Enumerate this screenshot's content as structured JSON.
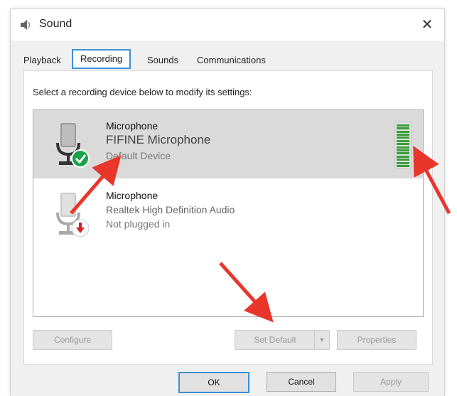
{
  "window": {
    "title": "Sound",
    "icon": "speaker-icon",
    "close_glyph": "✕"
  },
  "tabs": [
    {
      "label": "Playback",
      "active": false
    },
    {
      "label": "Recording",
      "active": true
    },
    {
      "label": "Sounds",
      "active": false
    },
    {
      "label": "Communications",
      "active": false
    }
  ],
  "instruction": "Select a recording device below to modify its settings:",
  "devices": [
    {
      "name": "Microphone",
      "description": "FIFINE Microphone",
      "status": "Default Device",
      "selected": true,
      "badge": "check-badge-icon",
      "level_fraction": 1.0
    },
    {
      "name": "Microphone",
      "description": "Realtek High Definition Audio",
      "status": "Not plugged in",
      "selected": false,
      "badge": "unplugged-badge-icon"
    }
  ],
  "buttons": {
    "configure": "Configure",
    "set_default": "Set Default",
    "properties": "Properties",
    "ok": "OK",
    "cancel": "Cancel",
    "apply": "Apply"
  },
  "colors": {
    "accent": "#3b8fd6",
    "arrow": "#e8362b",
    "level": "#3a9e3a",
    "check": "#19a34a",
    "unplugged": "#d32222"
  }
}
